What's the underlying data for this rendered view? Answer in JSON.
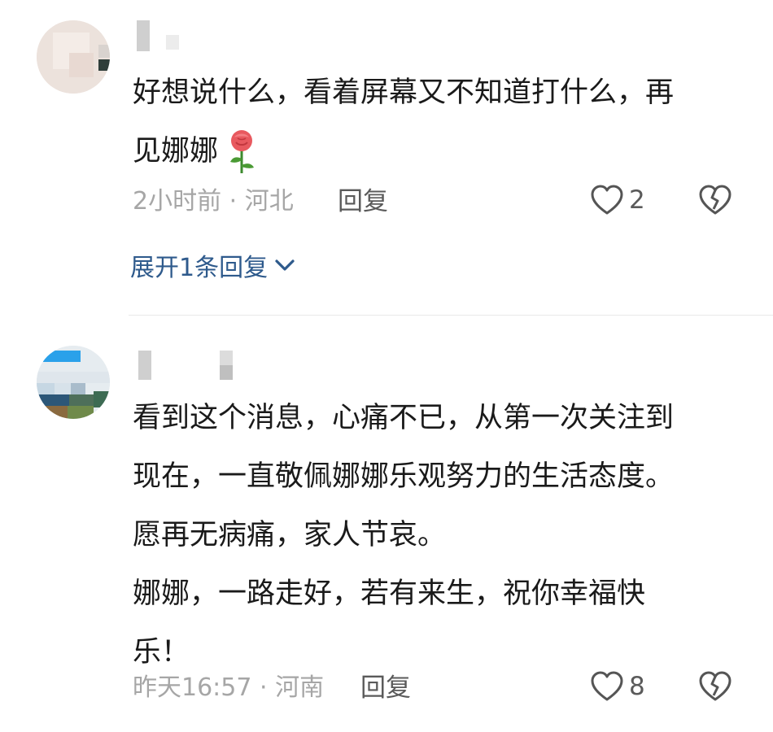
{
  "comments": [
    {
      "text": "好想说什么，看着屏幕又不知道打什么，再\n见娜娜",
      "emoji": "rose",
      "meta": "2小时前 · 河北",
      "reply_label": "回复",
      "like_count": "2",
      "expand_replies": "展开1条回复"
    },
    {
      "text": "看到这个消息，心痛不已，从第一次关注到\n现在，一直敬佩娜娜乐观努力的生活态度。\n愿再无病痛，家人节哀。\n娜娜，一路走好，若有来生，祝你幸福快\n乐！",
      "meta": "昨天16:57 · 河南",
      "reply_label": "回复",
      "like_count": "8"
    }
  ],
  "icons": {
    "like": "heart-outline-icon",
    "dislike": "broken-heart-icon",
    "expand": "chevron-down-icon"
  },
  "colors": {
    "link": "#2e5a8c",
    "meta": "#a6a6a6",
    "text": "#1a1a1a"
  }
}
